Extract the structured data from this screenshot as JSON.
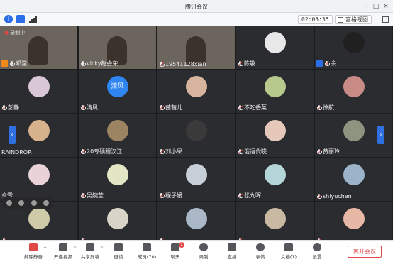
{
  "window": {
    "title": "腾讯会议"
  },
  "infobar": {
    "time": "02:05:35",
    "view_label": "宫格视图"
  },
  "recording_label": "录制中",
  "participants": [
    {
      "name": "邓滢",
      "video": true,
      "host": true,
      "mic": "on",
      "recording": true
    },
    {
      "name": "vicky赵会荣",
      "video": true,
      "mic": "on"
    },
    {
      "name": "19541128xian",
      "video": true,
      "mic": "muted"
    },
    {
      "name": "陈敬",
      "mic": "muted",
      "avatar_color": "#e8e8e8"
    },
    {
      "name": "余",
      "host_blue": true,
      "mic": "muted",
      "avatar_color": "#202020"
    },
    {
      "name": "彭静",
      "mic": "muted",
      "avatar_color": "#d9c6d6"
    },
    {
      "name": "清风",
      "mic": "muted",
      "avatar_text": "清风"
    },
    {
      "name": "茜茜儿",
      "mic": "muted",
      "avatar_color": "#d7b49d"
    },
    {
      "name": "不吃香菜",
      "mic": "muted",
      "avatar_color": "#b8c98e"
    },
    {
      "name": "徐航",
      "mic": "muted",
      "avatar_color": "#c98b86"
    },
    {
      "name": "RAINDROP.",
      "mic": "none",
      "avatar_color": "#d6b38c"
    },
    {
      "name": "20专硕程汉江",
      "mic": "muted",
      "avatar_color": "#9c8462"
    },
    {
      "name": "刘小呆",
      "mic": "muted",
      "avatar_color": "#3a3a3a"
    },
    {
      "name": "俄语代晓",
      "mic": "muted",
      "avatar_color": "#e6c8ba"
    },
    {
      "name": "黄丽玲",
      "mic": "muted",
      "avatar_color": "#8d9480"
    },
    {
      "name": "佘雪",
      "mic": "none",
      "avatar_color": "#e9d2d8"
    },
    {
      "name": "吴婉莹",
      "mic": "muted",
      "avatar_color": "#e2e6c4"
    },
    {
      "name": "程子媛",
      "mic": "muted",
      "avatar_color": "#c7d0d8"
    },
    {
      "name": "张九晖",
      "mic": "muted",
      "avatar_color": "#b4d6d9"
    },
    {
      "name": "shiyuchen",
      "mic": "muted",
      "avatar_color": "#9bb4c9"
    },
    {
      "name": "",
      "mic": "muted",
      "avatar_color": "#cfcaa8"
    },
    {
      "name": "",
      "mic": "muted",
      "avatar_color": "#d8d4c8"
    },
    {
      "name": "",
      "mic": "muted",
      "avatar_color": "#a9b7c6"
    },
    {
      "name": "",
      "mic": "muted",
      "avatar_color": "#c9b9a3"
    },
    {
      "name": "",
      "mic": "muted",
      "avatar_color": "#e7b8a6"
    }
  ],
  "toolbar": {
    "unmute": "解除静音",
    "video": "开启视频",
    "share": "共享屏幕",
    "invite": "邀请",
    "members": "成员(70)",
    "chat": "聊天",
    "chat_badge": "1",
    "record": "录制",
    "live": "直播",
    "reaction": "表情",
    "docs": "文档(1)",
    "settings": "设置",
    "leave": "离开会议"
  }
}
